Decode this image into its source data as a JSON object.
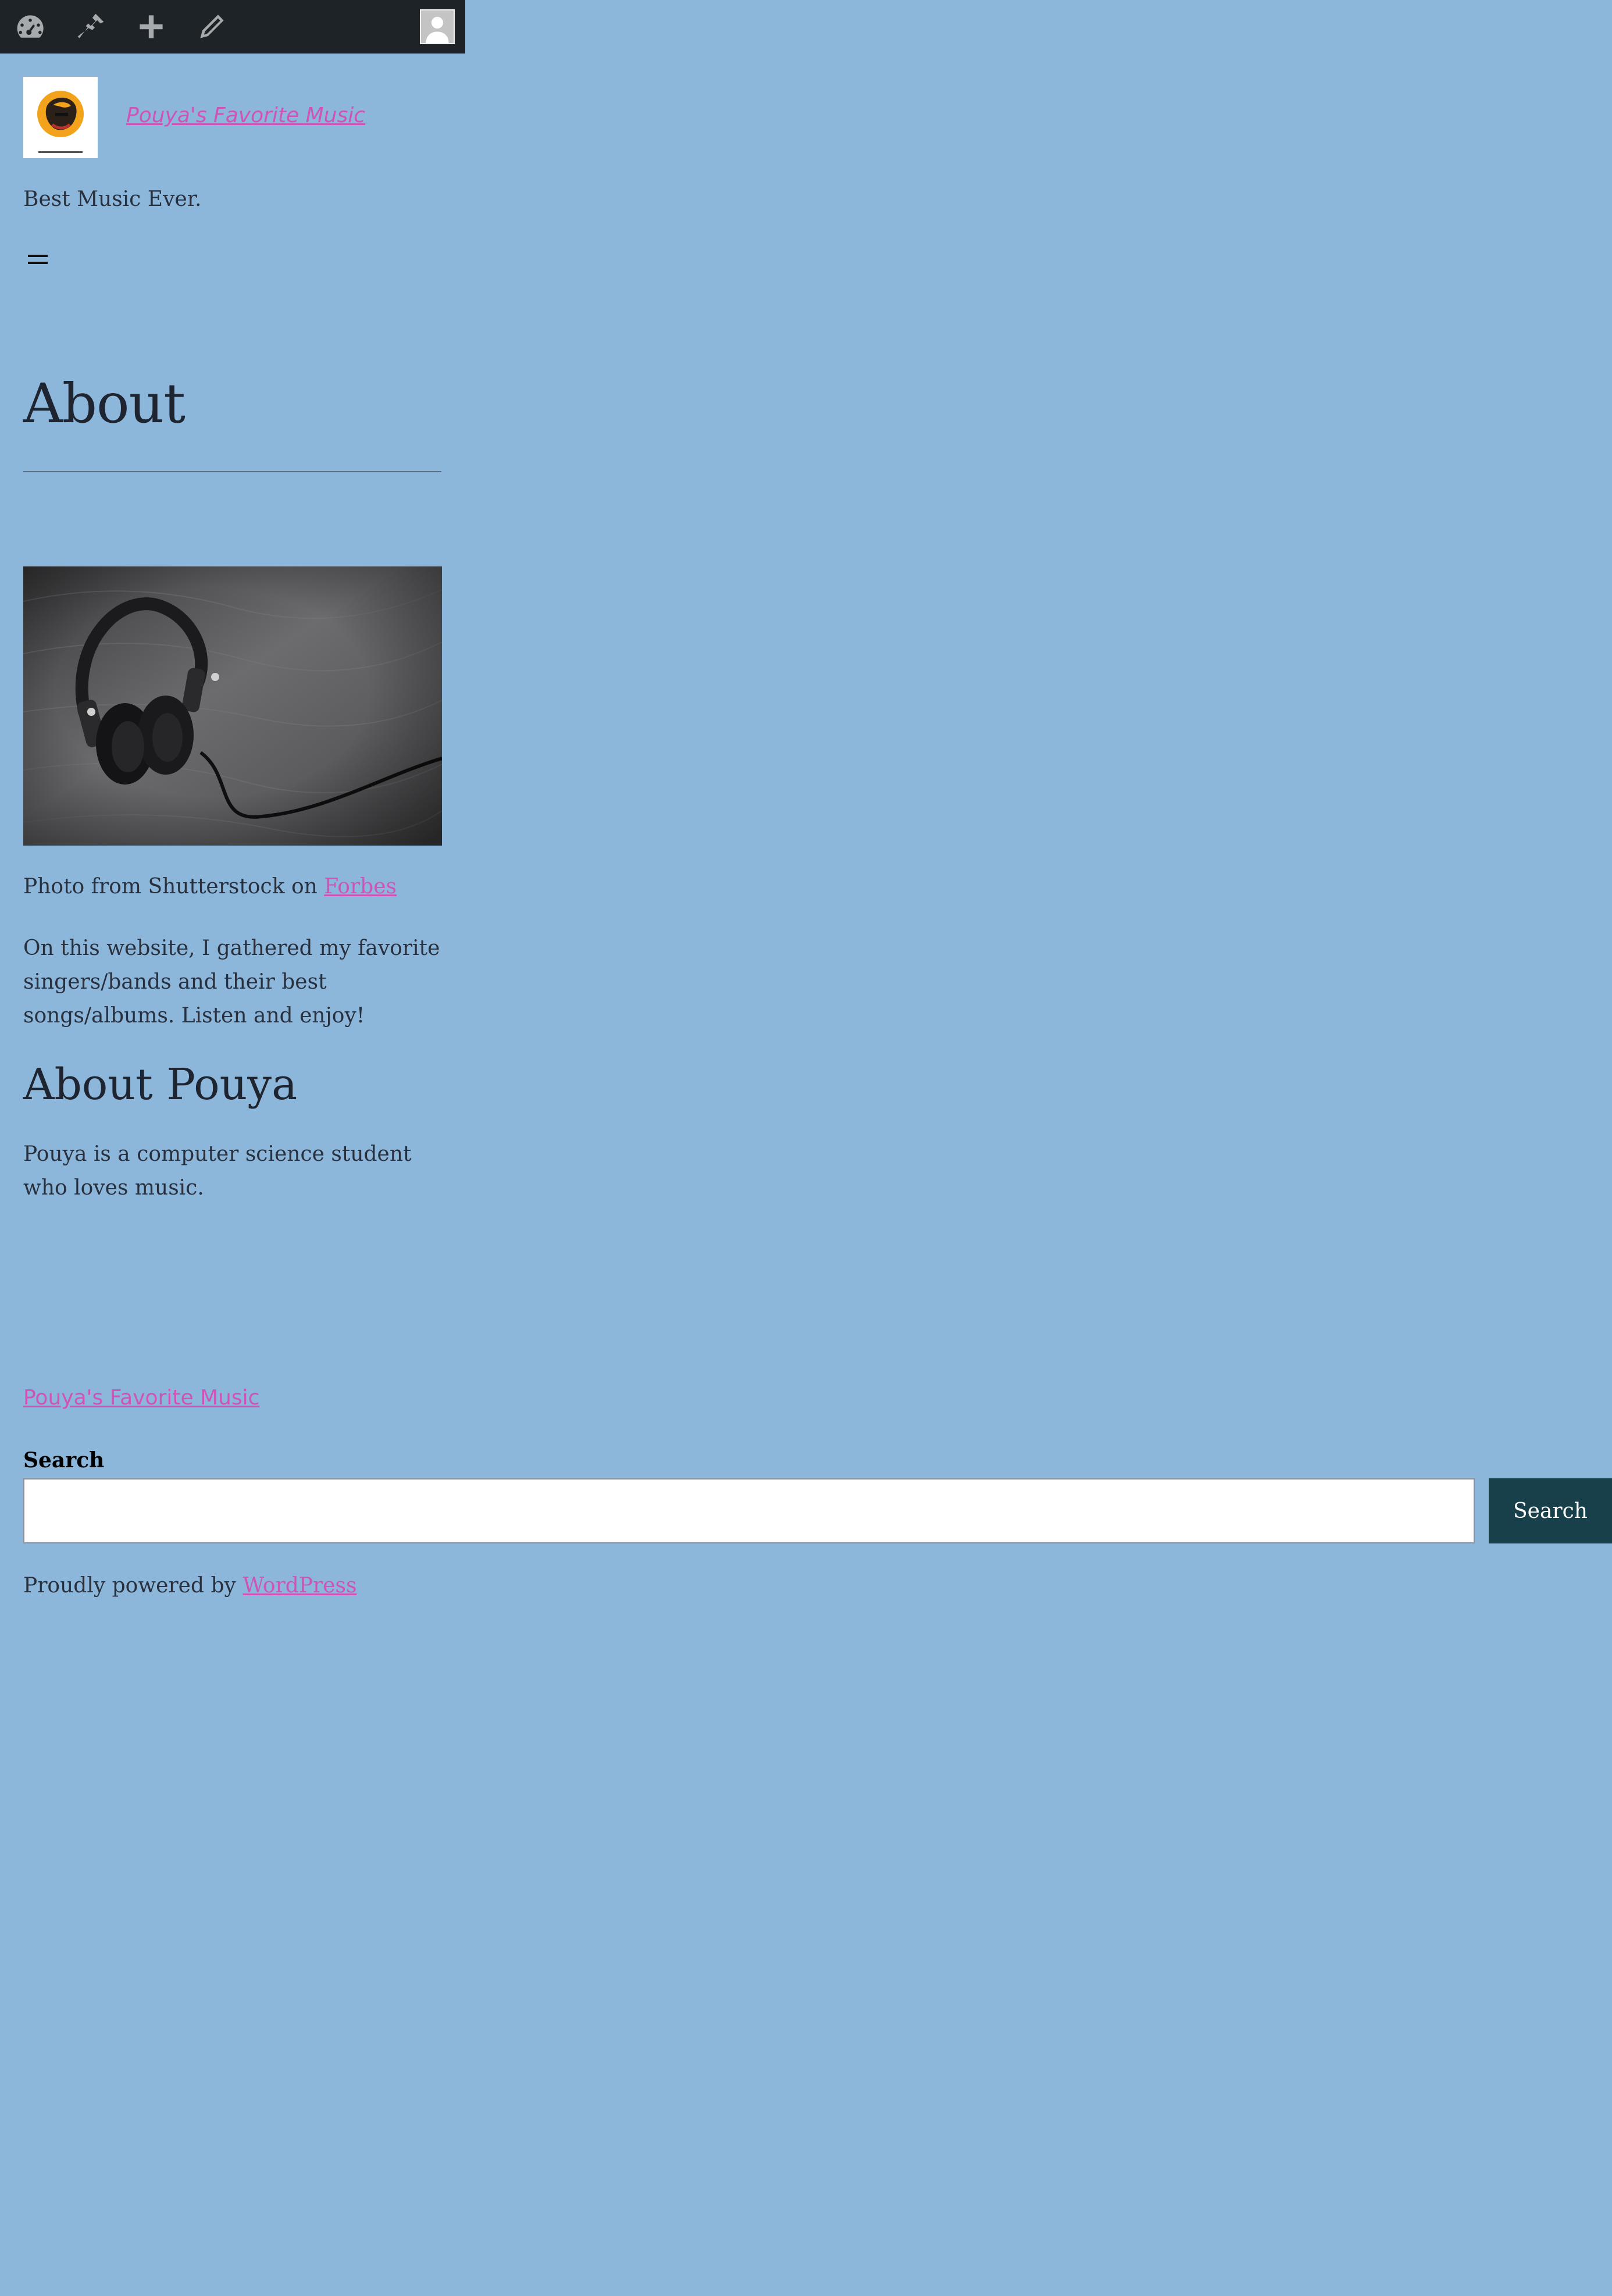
{
  "admin_bar": {
    "icons": [
      "dashboard-icon",
      "customize-icon",
      "new-content-icon",
      "edit-icon",
      "avatar"
    ]
  },
  "site": {
    "title": "Pouya's Favorite Music",
    "tagline": "Best Music Ever."
  },
  "page": {
    "title": "About",
    "caption_prefix": "Photo from Shutterstock on",
    "caption_link": "Forbes",
    "intro": "On this website, I gathered my favorite singers/bands and their best songs/albums. Listen and enjoy!",
    "about_heading": "About Pouya",
    "bio": "Pouya is a computer science student who loves music."
  },
  "footer": {
    "site_title": "Pouya's Favorite Music",
    "search_label": "Search",
    "search_value": "",
    "search_button": "Search",
    "powered_prefix": "Proudly powered by",
    "powered_link": "WordPress"
  },
  "colors": {
    "background": "#8db6db",
    "link": "#d053b8",
    "admin_bar": "#1d2327",
    "button": "#17404a"
  }
}
